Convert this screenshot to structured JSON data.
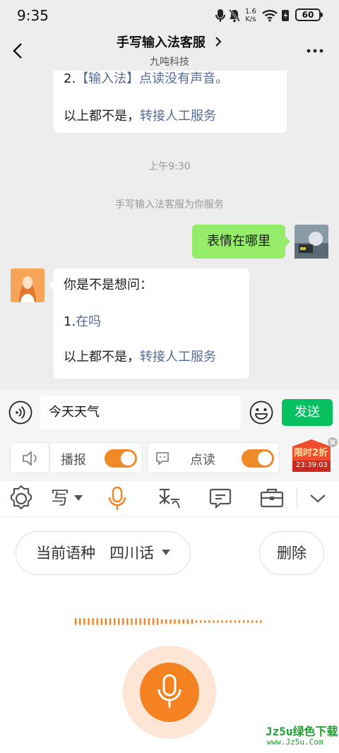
{
  "status_bar": {
    "time": "9:35",
    "net_speed_value": "1.6",
    "net_speed_unit": "K/s",
    "battery": "60"
  },
  "header": {
    "title": "手写输入法客服",
    "subtitle": "九吨科技"
  },
  "chat": {
    "bubble1": {
      "line1_prefix": "2.",
      "line1_link": "【输入法】点读没有声音。",
      "line2_text": "以上都不是，",
      "line2_link": "转接人工服务"
    },
    "timestamp": "上午9:30",
    "system_notice": "手写输入法客服为你服务",
    "my_message": "表情在哪里",
    "bubble2": {
      "line1": "你是不是想问：",
      "option_prefix": "1.",
      "option_link": "在吗",
      "line3_text": "以上都不是，",
      "line3_link": "转接人工服务"
    }
  },
  "input": {
    "value": "今天天气",
    "send_label": "发送"
  },
  "toggles": {
    "broadcast_label": "播报",
    "broadcast_on": true,
    "point_read_label": "点读",
    "point_read_on": true
  },
  "promo": {
    "label": "限时2折",
    "countdown": "23:39:03"
  },
  "toolbar": {
    "handwrite_label": "写"
  },
  "voice": {
    "lang_prefix": "当前语种",
    "lang_value": "四川话",
    "delete_label": "删除"
  },
  "watermark": {
    "line1": "Jz5u绿色下载",
    "line2": "www.Jz5u.Com"
  },
  "colors": {
    "accent_orange": "#f58220",
    "send_green": "#07c160",
    "my_bubble": "#95ec69",
    "link_blue": "#576b95"
  }
}
